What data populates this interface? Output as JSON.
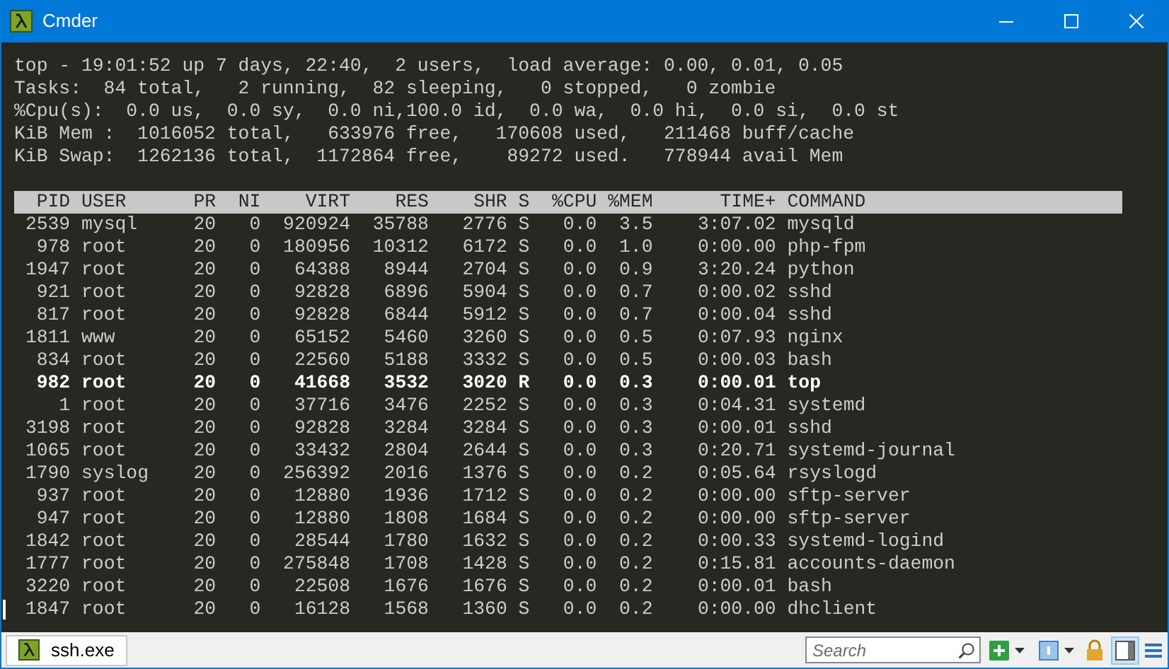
{
  "window": {
    "title": "Cmder"
  },
  "summary": [
    "top - 19:01:52 up 7 days, 22:40,  2 users,  load average: 0.00, 0.01, 0.05",
    "Tasks:  84 total,   2 running,  82 sleeping,   0 stopped,   0 zombie",
    "%Cpu(s):  0.0 us,  0.0 sy,  0.0 ni,100.0 id,  0.0 wa,  0.0 hi,  0.0 si,  0.0 st",
    "KiB Mem :  1016052 total,   633976 free,   170608 used,   211468 buff/cache",
    "KiB Swap:  1262136 total,  1172864 free,    89272 used.   778944 avail Mem"
  ],
  "table": {
    "columns": [
      "PID",
      "USER",
      "PR",
      "NI",
      "VIRT",
      "RES",
      "SHR",
      "S",
      "%CPU",
      "%MEM",
      "TIME+",
      "COMMAND"
    ],
    "rows": [
      {
        "cells": [
          "2539",
          "mysql",
          "20",
          "0",
          "920924",
          "35788",
          "2776",
          "S",
          "0.0",
          "3.5",
          "3:07.02",
          "mysqld"
        ],
        "highlighted": false
      },
      {
        "cells": [
          "978",
          "root",
          "20",
          "0",
          "180956",
          "10312",
          "6172",
          "S",
          "0.0",
          "1.0",
          "0:00.00",
          "php-fpm"
        ],
        "highlighted": false
      },
      {
        "cells": [
          "1947",
          "root",
          "20",
          "0",
          "64388",
          "8944",
          "2704",
          "S",
          "0.0",
          "0.9",
          "3:20.24",
          "python"
        ],
        "highlighted": false
      },
      {
        "cells": [
          "921",
          "root",
          "20",
          "0",
          "92828",
          "6896",
          "5904",
          "S",
          "0.0",
          "0.7",
          "0:00.02",
          "sshd"
        ],
        "highlighted": false
      },
      {
        "cells": [
          "817",
          "root",
          "20",
          "0",
          "92828",
          "6844",
          "5912",
          "S",
          "0.0",
          "0.7",
          "0:00.04",
          "sshd"
        ],
        "highlighted": false
      },
      {
        "cells": [
          "1811",
          "www",
          "20",
          "0",
          "65152",
          "5460",
          "3260",
          "S",
          "0.0",
          "0.5",
          "0:07.93",
          "nginx"
        ],
        "highlighted": false
      },
      {
        "cells": [
          "834",
          "root",
          "20",
          "0",
          "22560",
          "5188",
          "3332",
          "S",
          "0.0",
          "0.5",
          "0:00.03",
          "bash"
        ],
        "highlighted": false
      },
      {
        "cells": [
          "982",
          "root",
          "20",
          "0",
          "41668",
          "3532",
          "3020",
          "R",
          "0.0",
          "0.3",
          "0:00.01",
          "top"
        ],
        "highlighted": true
      },
      {
        "cells": [
          "1",
          "root",
          "20",
          "0",
          "37716",
          "3476",
          "2252",
          "S",
          "0.0",
          "0.3",
          "0:04.31",
          "systemd"
        ],
        "highlighted": false
      },
      {
        "cells": [
          "3198",
          "root",
          "20",
          "0",
          "92828",
          "3284",
          "3284",
          "S",
          "0.0",
          "0.3",
          "0:00.01",
          "sshd"
        ],
        "highlighted": false
      },
      {
        "cells": [
          "1065",
          "root",
          "20",
          "0",
          "33432",
          "2804",
          "2644",
          "S",
          "0.0",
          "0.3",
          "0:20.71",
          "systemd-journal"
        ],
        "highlighted": false
      },
      {
        "cells": [
          "1790",
          "syslog",
          "20",
          "0",
          "256392",
          "2016",
          "1376",
          "S",
          "0.0",
          "0.2",
          "0:05.64",
          "rsyslogd"
        ],
        "highlighted": false
      },
      {
        "cells": [
          "937",
          "root",
          "20",
          "0",
          "12880",
          "1936",
          "1712",
          "S",
          "0.0",
          "0.2",
          "0:00.00",
          "sftp-server"
        ],
        "highlighted": false
      },
      {
        "cells": [
          "947",
          "root",
          "20",
          "0",
          "12880",
          "1808",
          "1684",
          "S",
          "0.0",
          "0.2",
          "0:00.00",
          "sftp-server"
        ],
        "highlighted": false
      },
      {
        "cells": [
          "1842",
          "root",
          "20",
          "0",
          "28544",
          "1780",
          "1632",
          "S",
          "0.0",
          "0.2",
          "0:00.33",
          "systemd-logind"
        ],
        "highlighted": false
      },
      {
        "cells": [
          "1777",
          "root",
          "20",
          "0",
          "275848",
          "1708",
          "1428",
          "S",
          "0.0",
          "0.2",
          "0:15.81",
          "accounts-daemon"
        ],
        "highlighted": false
      },
      {
        "cells": [
          "3220",
          "root",
          "20",
          "0",
          "22508",
          "1676",
          "1676",
          "S",
          "0.0",
          "0.2",
          "0:00.01",
          "bash"
        ],
        "highlighted": false
      },
      {
        "cells": [
          "1847",
          "root",
          "20",
          "0",
          "16128",
          "1568",
          "1360",
          "S",
          "0.0",
          "0.2",
          "0:00.00",
          "dhclient"
        ],
        "highlighted": false
      }
    ]
  },
  "status_bar": {
    "tabs": [
      {
        "label": "ssh.exe",
        "selected": true
      }
    ],
    "search": {
      "placeholder": "Search"
    }
  }
}
